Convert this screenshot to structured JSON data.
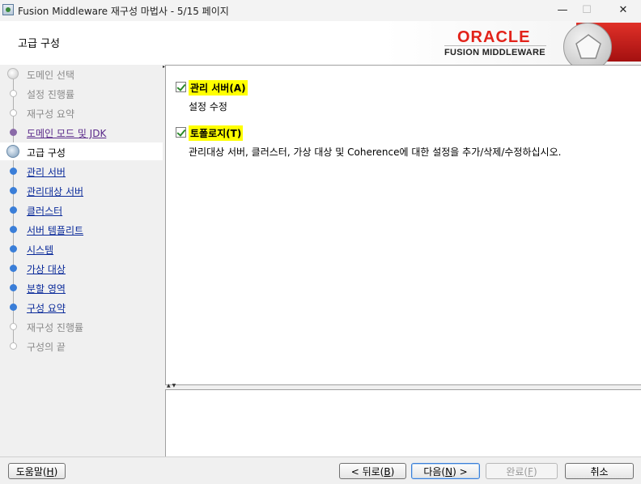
{
  "window": {
    "title": "Fusion Middleware 재구성 마법사 - 5/15 페이지",
    "minimize_glyph": "—",
    "maximize_glyph": "☐",
    "close_glyph": "✕"
  },
  "header": {
    "page_title": "고급 구성",
    "brand": "ORACLE",
    "product": "FUSION MIDDLEWARE",
    "colors": {
      "brand_red": "#e2231a"
    }
  },
  "nav": {
    "items": [
      {
        "label": "도메인 선택",
        "state": "done"
      },
      {
        "label": "설정 진행률",
        "state": "disabled"
      },
      {
        "label": "재구성 요약",
        "state": "disabled"
      },
      {
        "label": "도메인 모드 및 JDK",
        "state": "visited"
      },
      {
        "label": "고급 구성",
        "state": "current"
      },
      {
        "label": "관리 서버",
        "state": "link"
      },
      {
        "label": "관리대상 서버",
        "state": "link"
      },
      {
        "label": "클러스터",
        "state": "link"
      },
      {
        "label": "서버 템플리트",
        "state": "link"
      },
      {
        "label": "시스템",
        "state": "link"
      },
      {
        "label": "가상 대상",
        "state": "link"
      },
      {
        "label": "분할 영역",
        "state": "link"
      },
      {
        "label": "구성 요약",
        "state": "link"
      },
      {
        "label": "재구성 진행률",
        "state": "disabled"
      },
      {
        "label": "구성의 끝",
        "state": "disabled"
      }
    ]
  },
  "main": {
    "options": [
      {
        "label": "관리 서버(A)",
        "checked": true,
        "description": "설정 수정"
      },
      {
        "label": "토폴로지(T)",
        "checked": true,
        "description": "관리대상 서버, 클러스터, 가상 대상 및 Coherence에 대한 설정을 추가/삭제/수정하십시오."
      }
    ]
  },
  "footer": {
    "help": {
      "text": "도움말(",
      "key": "H",
      "end": ")"
    },
    "back": {
      "text": "< 뒤로(",
      "key": "B",
      "end": ")"
    },
    "next": {
      "text": "다음(",
      "key": "N",
      "end": ") >"
    },
    "finish": {
      "text": "완료(",
      "key": "F",
      "end": ")"
    },
    "cancel": {
      "text": "취소"
    }
  }
}
